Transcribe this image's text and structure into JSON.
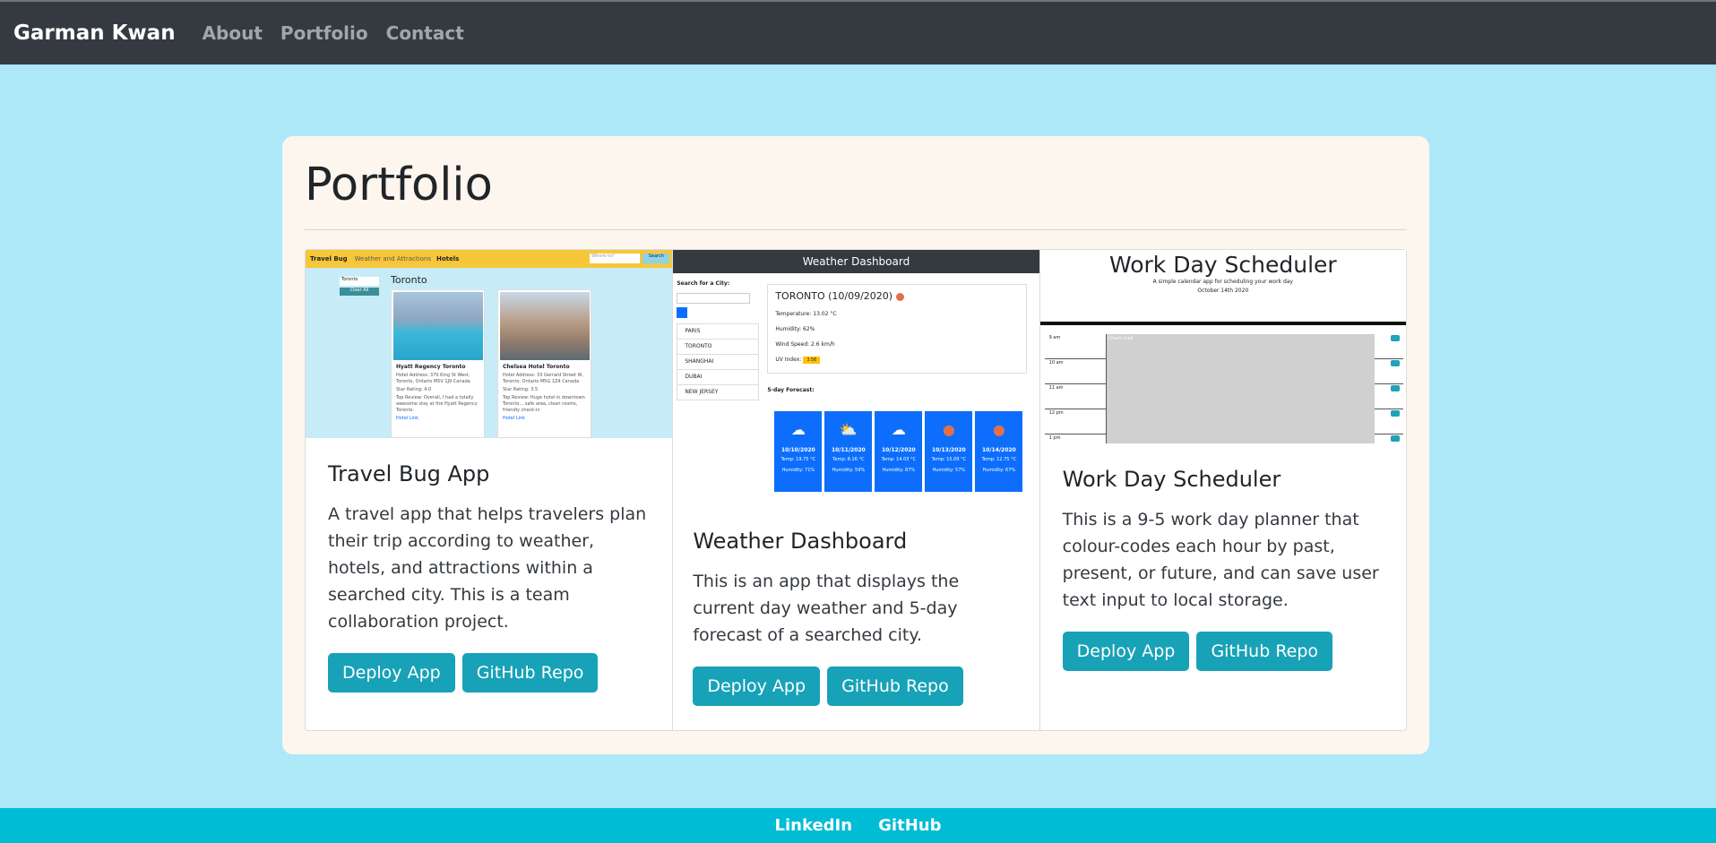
{
  "navbar": {
    "brand": "Garman Kwan",
    "links": [
      "About",
      "Portfolio",
      "Contact"
    ]
  },
  "page": {
    "title": "Portfolio"
  },
  "projects": [
    {
      "title": "Travel Bug App",
      "description": "A travel app that helps travelers plan their trip according to weather, hotels, and attractions within a searched city. This is a team collaboration project.",
      "deploy_label": "Deploy App",
      "repo_label": "GitHub Repo",
      "screenshot": {
        "logo": "Travel Bug",
        "nav_1": "Weather and Attractions",
        "nav_2": "Hotels",
        "search_placeholder": "Where to?",
        "search_button": "Search",
        "city_value": "Toronto",
        "clear_button": "Clear All",
        "heading": "Toronto",
        "hotels": [
          {
            "name": "Hyatt Regency Toronto",
            "address": "Hotel Address: 370 King St West, Toronto, Ontario M5V 1J9 Canada",
            "rating": "Star Rating: 4.0",
            "review": "Top Review: Overall, I had a totally awesome stay at the Hyatt Regency Toronto.",
            "link": "Hotel Link"
          },
          {
            "name": "Chelsea Hotel Toronto",
            "address": "Hotel Address: 33 Gerrard Street W, Toronto, Ontario M5G 1Z4 Canada",
            "rating": "Star Rating: 3.5",
            "review": "Top Review: Huge hotel in downtown Toronto... safe area, clean rooms, friendly check-in",
            "link": "Hotel Link"
          }
        ]
      }
    },
    {
      "title": "Weather Dashboard",
      "description": "This is an app that displays the current day weather and 5-day forecast of a searched city.",
      "deploy_label": "Deploy App",
      "repo_label": "GitHub Repo",
      "screenshot": {
        "header": "Weather Dashboard",
        "search_label": "Search for a City:",
        "history": [
          "PARIS",
          "TORONTO",
          "SHANGHAI",
          "DUBAI",
          "NEW JERSEY"
        ],
        "current_city": "TORONTO (10/09/2020)",
        "temperature": "Temperature: 13.02 °C",
        "humidity": "Humidity: 62%",
        "wind": "Wind Speed: 2.6 km/h",
        "uv_label": "UV Index:",
        "uv_value": "3.56",
        "forecast_label": "5-day Forecast:",
        "forecast": [
          {
            "date": "10/10/2020",
            "temp": "Temp: 19.75 °C",
            "humidity": "Humidity: 71%",
            "icon": "☁"
          },
          {
            "date": "10/11/2020",
            "temp": "Temp: 8.16 °C",
            "humidity": "Humidity: 59%",
            "icon": "⛅"
          },
          {
            "date": "10/12/2020",
            "temp": "Temp: 14.03 °C",
            "humidity": "Humidity: 87%",
            "icon": "☁"
          },
          {
            "date": "10/13/2020",
            "temp": "Temp: 15.09 °C",
            "humidity": "Humidity: 57%",
            "icon": "●"
          },
          {
            "date": "10/14/2020",
            "temp": "Temp: 12.75 °C",
            "humidity": "Humidity: 67%",
            "icon": "●"
          }
        ]
      }
    },
    {
      "title": "Work Day Scheduler",
      "description": "This is a 9-5 work day planner that colour-codes each hour by past, present, or future, and can save user text input to local storage.",
      "deploy_label": "Deploy App",
      "repo_label": "GitHub Repo",
      "screenshot": {
        "title": "Work Day Scheduler",
        "subtitle": "A simple calendar app for scheduling your work day",
        "date": "October 14th 2020",
        "hours": [
          "9 am",
          "10 am",
          "11 am",
          "12 pm",
          "1 pm"
        ],
        "first_entry": "Check mail"
      }
    }
  ],
  "footer": {
    "links": [
      "LinkedIn",
      "GitHub"
    ]
  },
  "colors": {
    "background": "#aee9f9",
    "navbar": "#343a40",
    "container": "#fdf6ee",
    "button": "#17a2b8",
    "footer": "#00bcd4"
  }
}
